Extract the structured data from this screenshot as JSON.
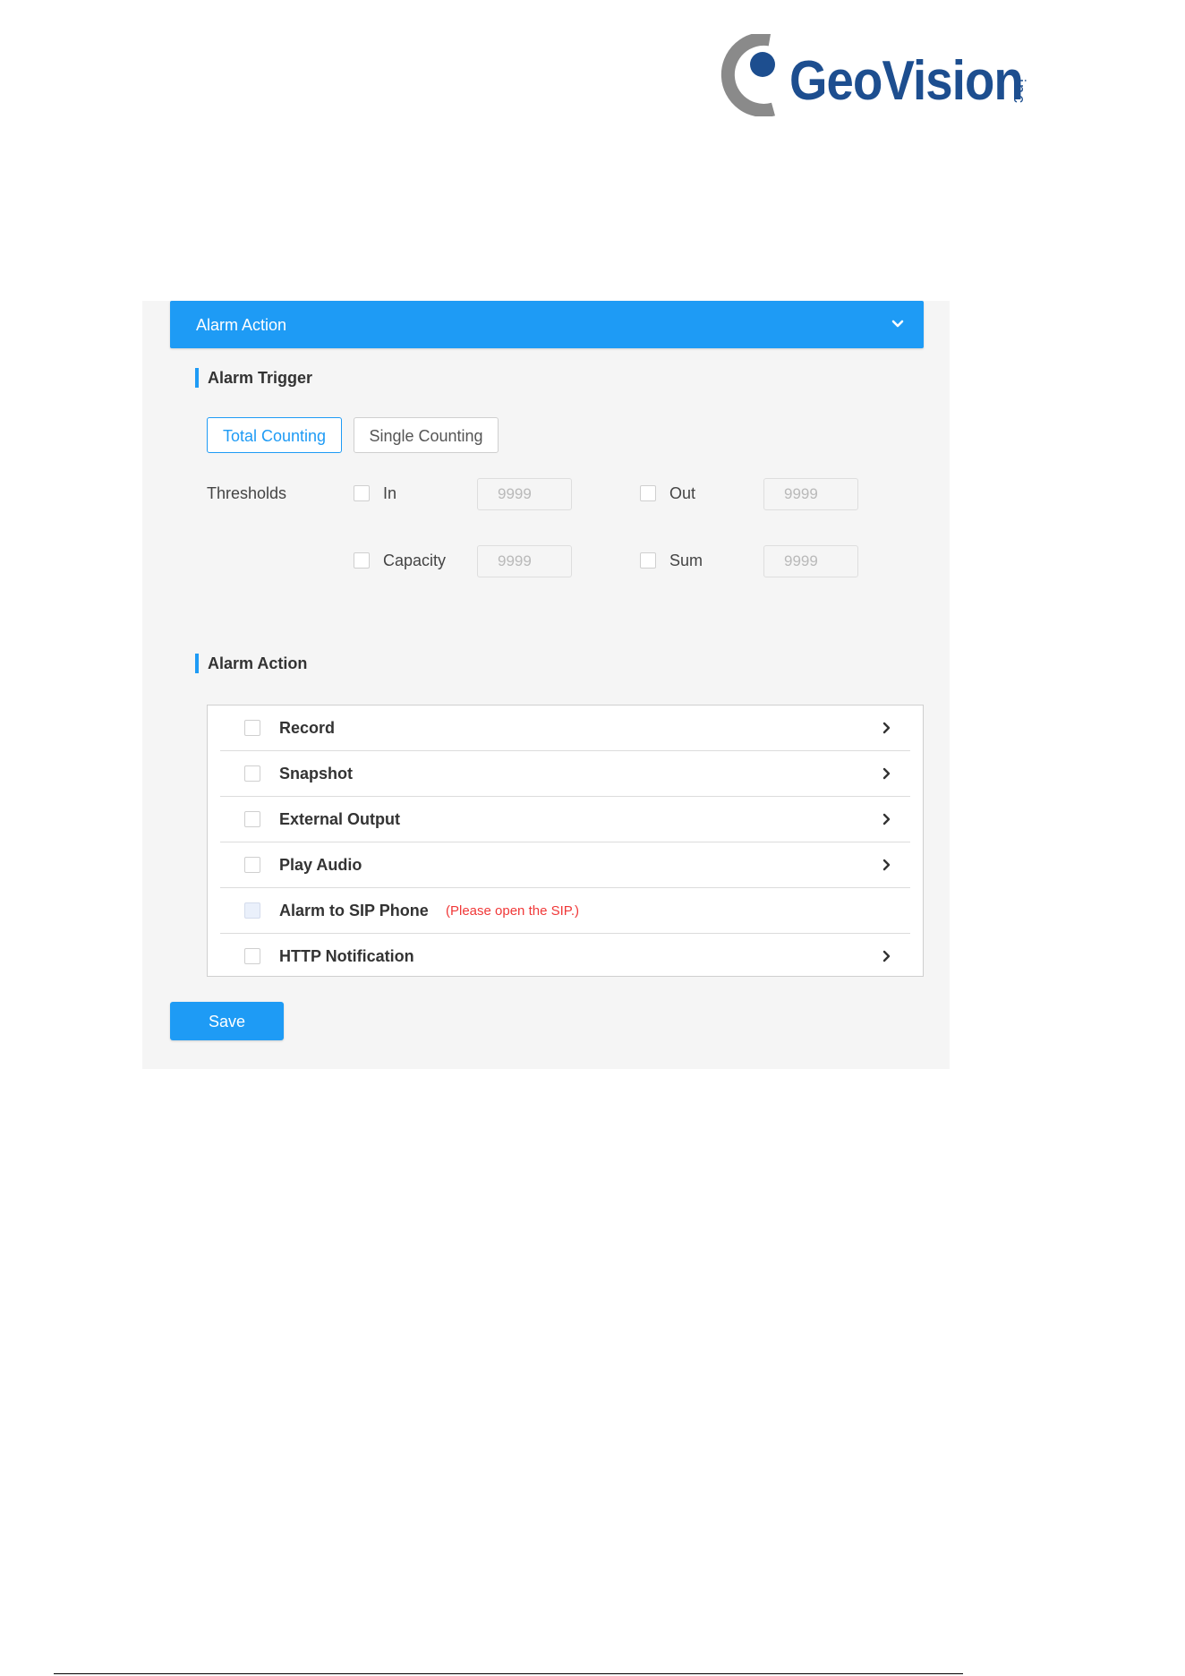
{
  "brand": {
    "name": "GeoVision",
    "suffix": "inc",
    "color": "#1d4e8f",
    "accent": "#1e9bf5"
  },
  "panel": {
    "header_title": "Alarm Action",
    "header_icon": "chevron-down-icon"
  },
  "trigger": {
    "title": "Alarm Trigger",
    "tabs": [
      {
        "label": "Total Counting",
        "active": true
      },
      {
        "label": "Single Counting",
        "active": false
      }
    ],
    "thresholds_label": "Thresholds",
    "fields": [
      {
        "label": "In",
        "placeholder": "9999",
        "checked": false
      },
      {
        "label": "Out",
        "placeholder": "9999",
        "checked": false
      },
      {
        "label": "Capacity",
        "placeholder": "9999",
        "checked": false
      },
      {
        "label": "Sum",
        "placeholder": "9999",
        "checked": false
      }
    ]
  },
  "action": {
    "title": "Alarm Action",
    "items": [
      {
        "label": "Record",
        "checked": false,
        "has_arrow": true
      },
      {
        "label": "Snapshot",
        "checked": false,
        "has_arrow": true
      },
      {
        "label": "External Output",
        "checked": false,
        "has_arrow": true
      },
      {
        "label": "Play Audio",
        "checked": false,
        "has_arrow": true
      },
      {
        "label": "Alarm to SIP Phone",
        "checked": false,
        "has_arrow": false,
        "note": "(Please open the SIP.)"
      },
      {
        "label": "HTTP Notification",
        "checked": false,
        "has_arrow": true
      }
    ]
  },
  "save_label": "Save"
}
